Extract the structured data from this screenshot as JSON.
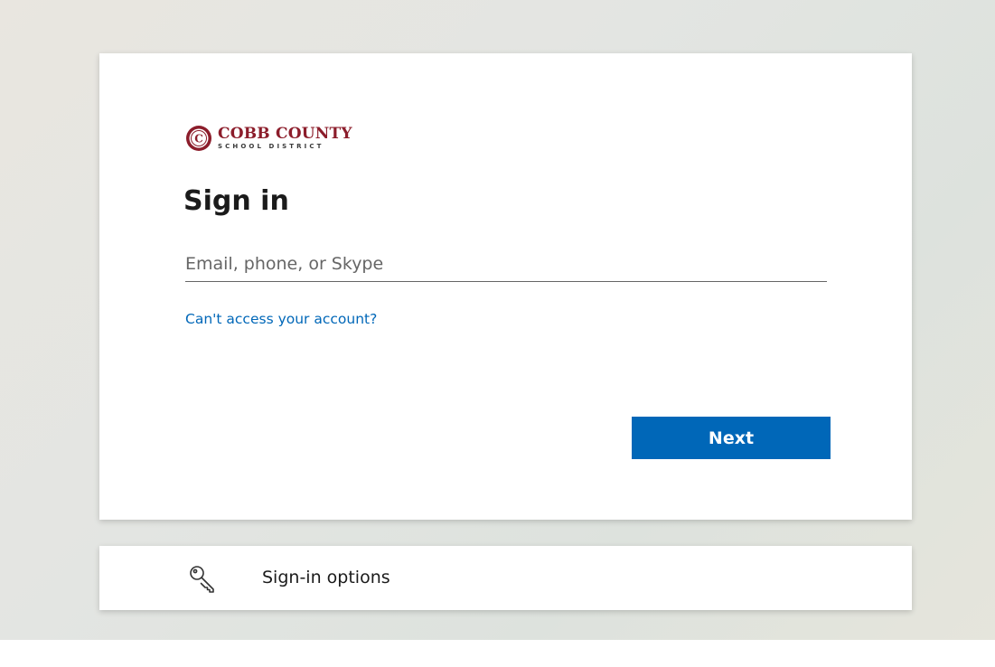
{
  "branding": {
    "org_name_line1": "COBB COUNTY",
    "org_name_line2": "SCHOOL DISTRICT",
    "seal_letter": "C",
    "brand_color": "#8c1d2b"
  },
  "signin": {
    "title": "Sign in",
    "email_placeholder": "Email, phone, or Skype",
    "email_value": "",
    "help_link": "Can't access your account?",
    "next_label": "Next",
    "accent_color": "#0067b8"
  },
  "options": {
    "label": "Sign-in options",
    "icon": "key-icon"
  }
}
